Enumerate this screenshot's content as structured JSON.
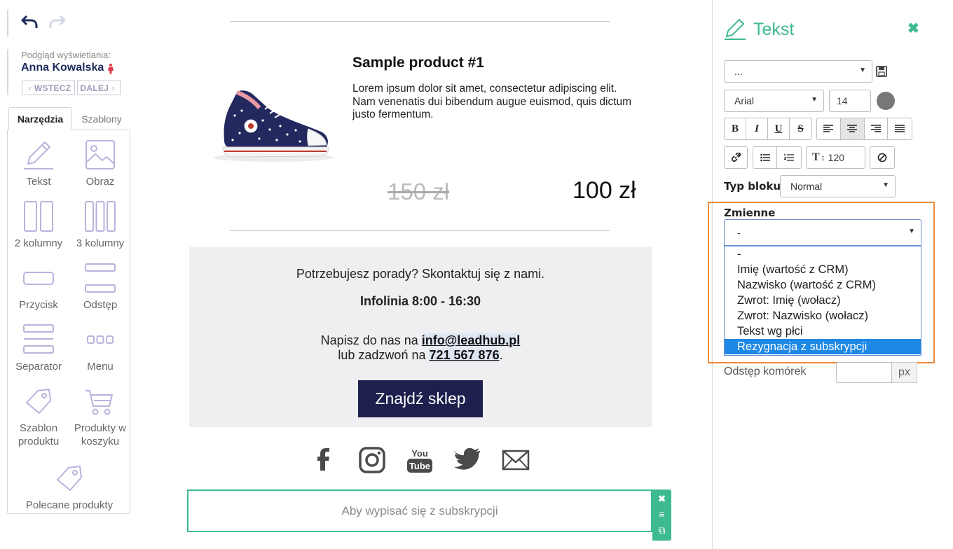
{
  "toolbar": {
    "undo_icon": "undo-arrow-icon",
    "redo_icon": "redo-arrow-icon"
  },
  "preview": {
    "label": "Podgląd wyświetlania:",
    "name": "Anna Kowalska",
    "back_label": "WSTECZ",
    "next_label": "DALEJ"
  },
  "tabs": {
    "tools": "Narzędzia",
    "templates": "Szablony"
  },
  "tools": [
    {
      "label": "Tekst",
      "icon": "pencil-icon"
    },
    {
      "label": "Obraz",
      "icon": "image-icon"
    },
    {
      "label": "2 kolumny",
      "icon": "two-columns-icon"
    },
    {
      "label": "3 kolumny",
      "icon": "three-columns-icon"
    },
    {
      "label": "Przycisk",
      "icon": "button-icon"
    },
    {
      "label": "Odstęp",
      "icon": "spacer-icon"
    },
    {
      "label": "Separator",
      "icon": "separator-icon"
    },
    {
      "label": "Menu",
      "icon": "menu-icon"
    },
    {
      "label": "Szablon produktu",
      "label_line1": "Szablon",
      "label_line2": "produktu",
      "icon": "tag-icon"
    },
    {
      "label": "Produkty w koszyku",
      "label_line1": "Produkty w",
      "label_line2": "koszyku",
      "icon": "cart-icon"
    },
    {
      "label": "Polecane produkty",
      "icon": "tag-icon"
    }
  ],
  "email": {
    "product": {
      "title": "Sample product #1",
      "description": "Lorem ipsum dolor sit amet, consectetur adipiscing elit. Nam venenatis dui bibendum augue euismod, quis dictum justo fermentum.",
      "old_price": "150 zł",
      "new_price": "100 zł"
    },
    "contact": {
      "headline": "Potrzebujesz porady? Skontaktuj się z nami.",
      "hours": "Infolinia 8:00 - 16:30",
      "write_prefix": "Napisz do nas na ",
      "email": "info@leadhub.pl",
      "call_prefix": "lub zadzwoń na ",
      "phone": "721 567 876",
      "call_suffix": ".",
      "button": "Znajdź sklep"
    },
    "social": [
      "facebook-icon",
      "instagram-icon",
      "youtube-icon",
      "twitter-icon",
      "mail-icon"
    ],
    "youtube_text_top": "You",
    "youtube_text_bottom": "Tube",
    "unsubscribe": "Aby wypisać się z subskrypcji"
  },
  "panel": {
    "title": "Tekst",
    "style_select": "...",
    "font": "Arial",
    "font_size": "14",
    "line_height": "120",
    "block_type_label": "Typ bloku:",
    "block_type_value": "Normal",
    "variables_label": "Zmienne",
    "variables_value": "-",
    "variables_options": [
      "-",
      "Imię (wartość z CRM)",
      "Nazwisko (wartość z CRM)",
      "Zwrot: Imię (wołacz)",
      "Zwrot: Nazwisko (wołacz)",
      "Tekst wg płci",
      "Rezygnacja z subskrypcji"
    ],
    "selected_option": "Rezygnacja z subskrypcji",
    "cell_spacing_label": "Odstęp komórek",
    "cell_spacing_unit": "px",
    "format_buttons": [
      "B",
      "I",
      "U",
      "S"
    ],
    "accent_color": "#3dbb8e",
    "highlight_color": "#ee8b3a"
  }
}
